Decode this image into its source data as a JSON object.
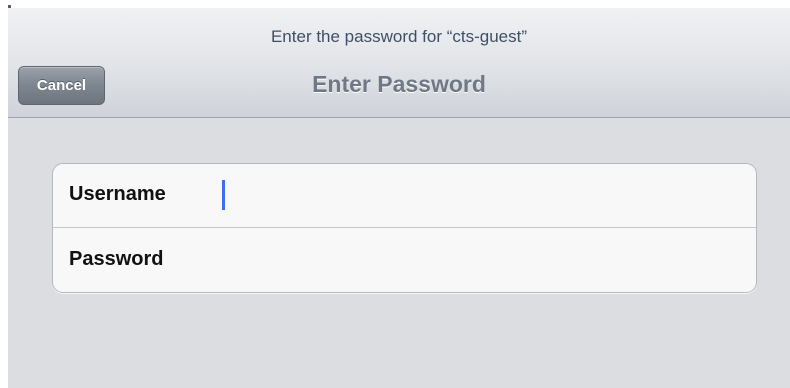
{
  "nav_bar": {
    "prompt": "Enter the password for “cts-guest”",
    "title": "Enter Password",
    "cancel_label": "Cancel"
  },
  "form": {
    "username": {
      "label": "Username",
      "value": ""
    },
    "password": {
      "label": "Password",
      "value": ""
    }
  },
  "colors": {
    "background": "#dcdde1",
    "cursor": "#3d6df2",
    "prompt_text": "#3f4f66",
    "title_text": "#6f7985"
  }
}
